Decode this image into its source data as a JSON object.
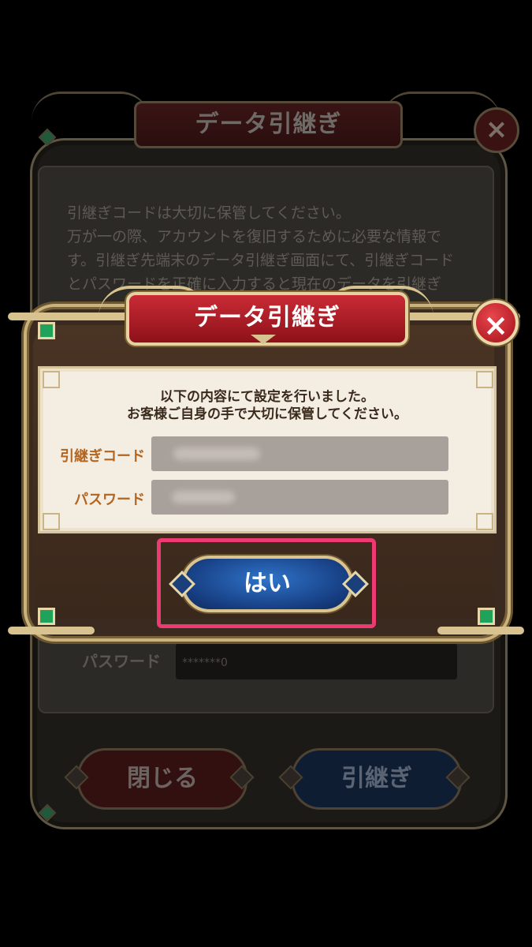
{
  "background_dialog": {
    "title": "データ引継ぎ",
    "close_icon": "×",
    "body_text": "引継ぎコードは大切に保管してください。\n万が一の際、アカウントを復旧するために必要な情報です。引継ぎ先端末のデータ引継ぎ画面にて、引継ぎコードとパスワードを正確に入力すると現在のデータを引継ぎ",
    "password_label": "パスワード",
    "password_value": "*******0",
    "close_button_label": "閉じる",
    "transfer_button_label": "引継ぎ"
  },
  "modal": {
    "title": "データ引継ぎ",
    "close_icon": "×",
    "message_line1": "以下の内容にて設定を行いました。",
    "message_line2": "お客様ご自身の手で大切に保管してください。",
    "transfer_code_label": "引継ぎコード",
    "password_label": "パスワード",
    "yes_button_label": "はい"
  },
  "colors": {
    "title_red": "#c92b35",
    "gold_border": "#d9c48f",
    "yes_blue": "#2f74c9",
    "highlight_pink": "#ee3a72",
    "label_orange": "#b3651f"
  }
}
